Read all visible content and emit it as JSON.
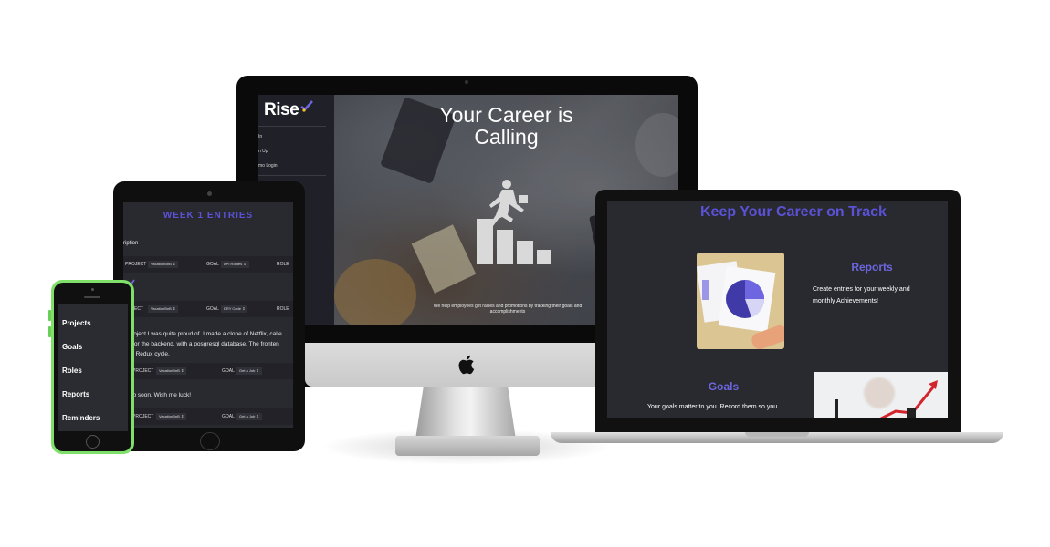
{
  "desktop": {
    "logo": "Rise",
    "nav": [
      "In",
      "n Up",
      "mo Login"
    ],
    "hero_title_line1": "Your Career is",
    "hero_title_line2": "Calling",
    "hero_subtitle": "We help employees get raises and promotions by tracking their goals and accomplishments"
  },
  "laptop": {
    "title": "Keep Your Career on Track",
    "reports_heading": "Reports",
    "reports_text": "Create entries for your weekly and monthly Achievements!",
    "goals_heading": "Goals",
    "goals_text": "Your goals matter to you. Record them so you"
  },
  "tablet": {
    "title": "WEEK 1 ENTRIES",
    "description_label": "ription",
    "rows": [
      {
        "project_label": "PROJECT",
        "project_value": "VacationBnB ⇕",
        "goal_label": "GOAL",
        "goal_value": "API Routes ⇕",
        "role_label": "ROLE"
      },
      {
        "project_label": "ROJECT",
        "project_value": "VacationBnB ⇕",
        "goal_label": "GOAL",
        "goal_value": "DRY Code ⇕",
        "role_label": "ROLE"
      },
      {
        "project_label": "PROJECT",
        "project_value": "VacationBnB ⇕",
        "goal_label": "GOAL",
        "goal_value": "Get a Job ⇕"
      },
      {
        "project_label": "PROJECT",
        "project_value": "VacationBnB ⇕",
        "goal_label": "GOAL",
        "goal_value": "Get a Job ⇕"
      }
    ],
    "entry_text": [
      "a project I was quite proud of. I made a clone of Netflix, calle",
      "als for the backend, with a posgresql database. The fronten",
      "+ Redux cycle."
    ],
    "entry_text_2": "a job soon. Wish me luck!"
  },
  "phone": {
    "items": [
      "Projects",
      "Goals",
      "Roles",
      "Reports",
      "Reminders"
    ]
  },
  "colors": {
    "accent": "#5b52d6",
    "phone_body": "#7fe069",
    "screen_bg": "#292a30"
  }
}
